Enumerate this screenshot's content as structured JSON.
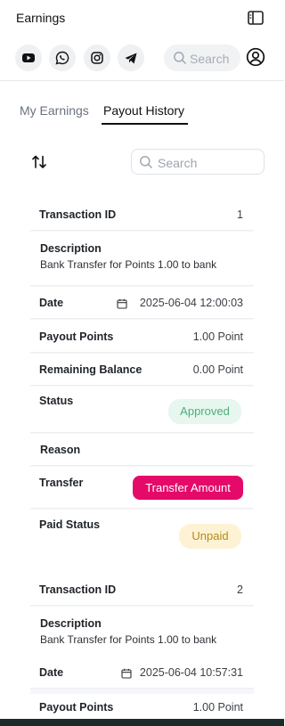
{
  "header": {
    "title": "Earnings"
  },
  "top_search": {
    "placeholder": "Search"
  },
  "social": [
    "youtube-icon",
    "whatsapp-icon",
    "instagram-icon",
    "telegram-icon"
  ],
  "tabs": [
    {
      "label": "My Earnings",
      "active": false
    },
    {
      "label": "Payout History",
      "active": true
    }
  ],
  "list_search": {
    "placeholder": "Search"
  },
  "labels": {
    "transaction_id": "Transaction ID",
    "description": "Description",
    "date": "Date",
    "payout_points": "Payout Points",
    "remaining_balance": "Remaining Balance",
    "status": "Status",
    "reason": "Reason",
    "transfer": "Transfer",
    "paid_status": "Paid Status"
  },
  "transactions": [
    {
      "id": "1",
      "description": "Bank Transfer for Points 1.00 to bank",
      "date": "2025-06-04 12:00:03",
      "payout_points": "1.00 Point",
      "remaining_balance": "0.00 Point",
      "status": "Approved",
      "reason": "",
      "transfer_button": "Transfer Amount",
      "paid_status": "Unpaid"
    },
    {
      "id": "2",
      "description": "Bank Transfer for Points 1.00 to bank",
      "date": "2025-06-04 10:57:31",
      "payout_points": "1.00 Point"
    }
  ],
  "colors": {
    "accent": "#e5096a",
    "approved_bg": "#e7f6ee",
    "approved_text": "#4caf7a",
    "unpaid_bg": "#fdf3d4",
    "unpaid_text": "#b58a1a"
  }
}
